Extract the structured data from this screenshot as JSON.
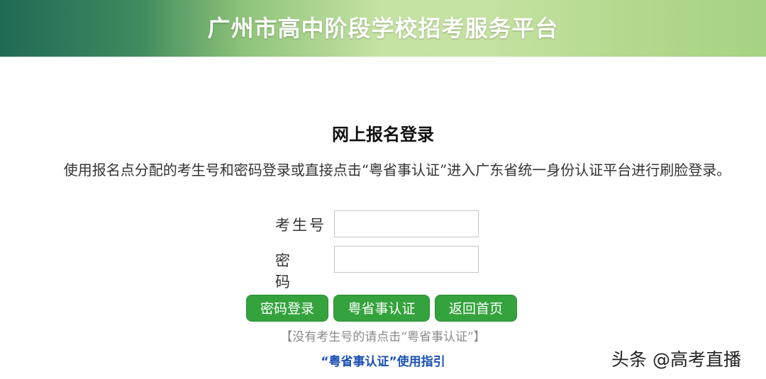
{
  "header": {
    "title": "广州市高中阶段学校招考服务平台"
  },
  "login": {
    "title": "网上报名登录",
    "instruction": "使用报名点分配的考生号和密码登录或直接点击“粤省事认证”进入广东省统一身份认证平台进行刷脸登录。",
    "exam_no_label": "考生号",
    "exam_no_value": "",
    "password_label": "密码",
    "password_value": ""
  },
  "buttons": {
    "password_login": "密码登录",
    "yueshengshi_auth": "粤省事认证",
    "back_home": "返回首页"
  },
  "hint": "【没有考生号的请点击“粤省事认证”】",
  "guide_link": "“粤省事认证”使用指引",
  "watermark": "头条 @高考直播",
  "colors": {
    "button_green": "#35a33d",
    "link_blue": "#1a4fb5",
    "banner_dark_green": "#1f6a55",
    "banner_light_green": "#c6e3a4"
  }
}
